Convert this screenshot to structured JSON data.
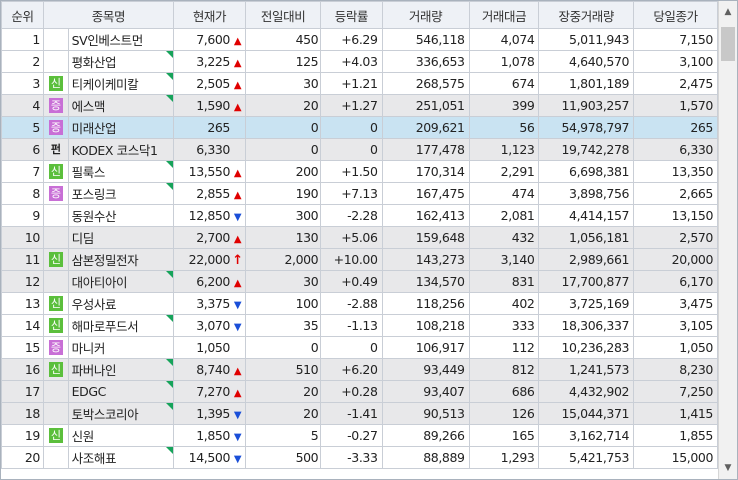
{
  "headers": {
    "rank": "순위",
    "name": "종목명",
    "price": "현재가",
    "change": "전일대비",
    "rate": "등락률",
    "volume": "거래량",
    "amount": "거래대금",
    "intraday_volume": "장중거래량",
    "close": "당일종가"
  },
  "scrollbar": {
    "up_icon": "▲",
    "down_icon": "▼"
  },
  "colors": {
    "up": "#e00000",
    "down": "#1a4fd8",
    "selected_row": "#c9e3f2",
    "alt_row": "#e8e8ea"
  },
  "rows": [
    {
      "rank": "1",
      "badge": "",
      "name": "SV인베스트먼",
      "tri": false,
      "price": "7,600",
      "dir": "up",
      "change": "450",
      "rate": "+6.29",
      "volume": "546,118",
      "amount": "4,074",
      "intraday": "5,011,943",
      "close": "7,150",
      "shade": ""
    },
    {
      "rank": "2",
      "badge": "",
      "name": "평화산업",
      "tri": true,
      "price": "3,225",
      "dir": "up",
      "change": "125",
      "rate": "+4.03",
      "volume": "336,653",
      "amount": "1,078",
      "intraday": "4,640,570",
      "close": "3,100",
      "shade": ""
    },
    {
      "rank": "3",
      "badge": "신",
      "badgeColor": "g",
      "name": "티케이케미칼",
      "tri": true,
      "price": "2,505",
      "dir": "up",
      "change": "30",
      "rate": "+1.21",
      "volume": "268,575",
      "amount": "674",
      "intraday": "1,801,189",
      "close": "2,475",
      "shade": ""
    },
    {
      "rank": "4",
      "badge": "증",
      "badgeColor": "p",
      "name": "에스맥",
      "tri": true,
      "price": "1,590",
      "dir": "up",
      "change": "20",
      "rate": "+1.27",
      "volume": "251,051",
      "amount": "399",
      "intraday": "11,903,257",
      "close": "1,570",
      "shade": "alt"
    },
    {
      "rank": "5",
      "badge": "증",
      "badgeColor": "p",
      "name": "미래산업",
      "tri": false,
      "price": "265",
      "dir": "flat",
      "change": "0",
      "rate": "0",
      "volume": "209,621",
      "amount": "56",
      "intraday": "54,978,797",
      "close": "265",
      "shade": "sel"
    },
    {
      "rank": "6",
      "badge": "펀",
      "badgeColor": "d",
      "name": "KODEX 코스닥1",
      "tri": false,
      "price": "6,330",
      "dir": "flat",
      "change": "0",
      "rate": "0",
      "volume": "177,478",
      "amount": "1,123",
      "intraday": "19,742,278",
      "close": "6,330",
      "shade": "alt"
    },
    {
      "rank": "7",
      "badge": "신",
      "badgeColor": "g",
      "name": "필룩스",
      "tri": true,
      "price": "13,550",
      "dir": "up",
      "change": "200",
      "rate": "+1.50",
      "volume": "170,314",
      "amount": "2,291",
      "intraday": "6,698,381",
      "close": "13,350",
      "shade": ""
    },
    {
      "rank": "8",
      "badge": "증",
      "badgeColor": "p",
      "name": "포스링크",
      "tri": true,
      "price": "2,855",
      "dir": "up",
      "change": "190",
      "rate": "+7.13",
      "volume": "167,475",
      "amount": "474",
      "intraday": "3,898,756",
      "close": "2,665",
      "shade": ""
    },
    {
      "rank": "9",
      "badge": "",
      "name": "동원수산",
      "tri": false,
      "price": "12,850",
      "dir": "down",
      "change": "300",
      "rate": "-2.28",
      "volume": "162,413",
      "amount": "2,081",
      "intraday": "4,414,157",
      "close": "13,150",
      "shade": ""
    },
    {
      "rank": "10",
      "badge": "",
      "name": "디딤",
      "tri": false,
      "price": "2,700",
      "dir": "up",
      "change": "130",
      "rate": "+5.06",
      "volume": "159,648",
      "amount": "432",
      "intraday": "1,056,181",
      "close": "2,570",
      "shade": "alt"
    },
    {
      "rank": "11",
      "badge": "신",
      "badgeColor": "g",
      "name": "삼본정밀전자",
      "tri": false,
      "price": "22,000",
      "dir": "upper",
      "change": "2,000",
      "rate": "+10.00",
      "volume": "143,273",
      "amount": "3,140",
      "intraday": "2,989,661",
      "close": "20,000",
      "shade": "alt"
    },
    {
      "rank": "12",
      "badge": "",
      "name": "대아티아이",
      "tri": true,
      "price": "6,200",
      "dir": "up",
      "change": "30",
      "rate": "+0.49",
      "volume": "134,570",
      "amount": "831",
      "intraday": "17,700,877",
      "close": "6,170",
      "shade": "alt"
    },
    {
      "rank": "13",
      "badge": "신",
      "badgeColor": "g",
      "name": "우성사료",
      "tri": false,
      "price": "3,375",
      "dir": "down",
      "change": "100",
      "rate": "-2.88",
      "volume": "118,256",
      "amount": "402",
      "intraday": "3,725,169",
      "close": "3,475",
      "shade": ""
    },
    {
      "rank": "14",
      "badge": "신",
      "badgeColor": "g",
      "name": "해마로푸드서",
      "tri": true,
      "price": "3,070",
      "dir": "down",
      "change": "35",
      "rate": "-1.13",
      "volume": "108,218",
      "amount": "333",
      "intraday": "18,306,337",
      "close": "3,105",
      "shade": ""
    },
    {
      "rank": "15",
      "badge": "증",
      "badgeColor": "p",
      "name": "마니커",
      "tri": false,
      "price": "1,050",
      "dir": "flat",
      "change": "0",
      "rate": "0",
      "volume": "106,917",
      "amount": "112",
      "intraday": "10,236,283",
      "close": "1,050",
      "shade": ""
    },
    {
      "rank": "16",
      "badge": "신",
      "badgeColor": "g",
      "name": "파버나인",
      "tri": true,
      "price": "8,740",
      "dir": "up",
      "change": "510",
      "rate": "+6.20",
      "volume": "93,449",
      "amount": "812",
      "intraday": "1,241,573",
      "close": "8,230",
      "shade": "alt"
    },
    {
      "rank": "17",
      "badge": "",
      "name": "EDGC",
      "tri": true,
      "price": "7,270",
      "dir": "up",
      "change": "20",
      "rate": "+0.28",
      "volume": "93,407",
      "amount": "686",
      "intraday": "4,432,902",
      "close": "7,250",
      "shade": "alt"
    },
    {
      "rank": "18",
      "badge": "",
      "name": "토박스코리아",
      "tri": true,
      "price": "1,395",
      "dir": "down",
      "change": "20",
      "rate": "-1.41",
      "volume": "90,513",
      "amount": "126",
      "intraday": "15,044,371",
      "close": "1,415",
      "shade": "alt"
    },
    {
      "rank": "19",
      "badge": "신",
      "badgeColor": "g",
      "name": "신원",
      "tri": false,
      "price": "1,850",
      "dir": "down",
      "change": "5",
      "rate": "-0.27",
      "volume": "89,266",
      "amount": "165",
      "intraday": "3,162,714",
      "close": "1,855",
      "shade": ""
    },
    {
      "rank": "20",
      "badge": "",
      "name": "사조해표",
      "tri": true,
      "price": "14,500",
      "dir": "down",
      "change": "500",
      "rate": "-3.33",
      "volume": "88,889",
      "amount": "1,293",
      "intraday": "5,421,753",
      "close": "15,000",
      "shade": ""
    }
  ]
}
